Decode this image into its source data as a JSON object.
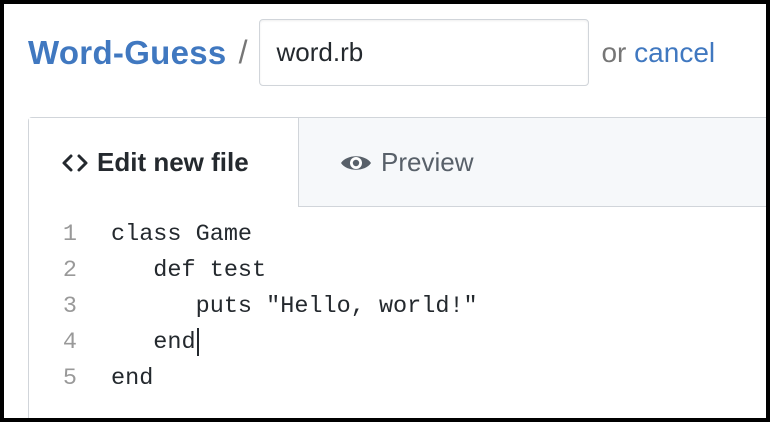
{
  "header": {
    "repo_name": "Word-Guess",
    "separator": "/",
    "filename_value": "word.rb",
    "or_text": "or",
    "cancel_label": "cancel"
  },
  "tabs": {
    "edit_label": "Edit new file",
    "preview_label": "Preview",
    "active": "edit"
  },
  "code": {
    "lines": [
      {
        "num": "1",
        "text": "class Game"
      },
      {
        "num": "2",
        "text": "   def test"
      },
      {
        "num": "3",
        "text": "      puts \"Hello, world!\""
      },
      {
        "num": "4",
        "text": "   end"
      },
      {
        "num": "5",
        "text": "end"
      }
    ],
    "caret_line": 4
  },
  "colors": {
    "link": "#4078c0",
    "muted": "#767676",
    "border": "#d1d5da",
    "tab_bg": "#f6f8fa"
  }
}
